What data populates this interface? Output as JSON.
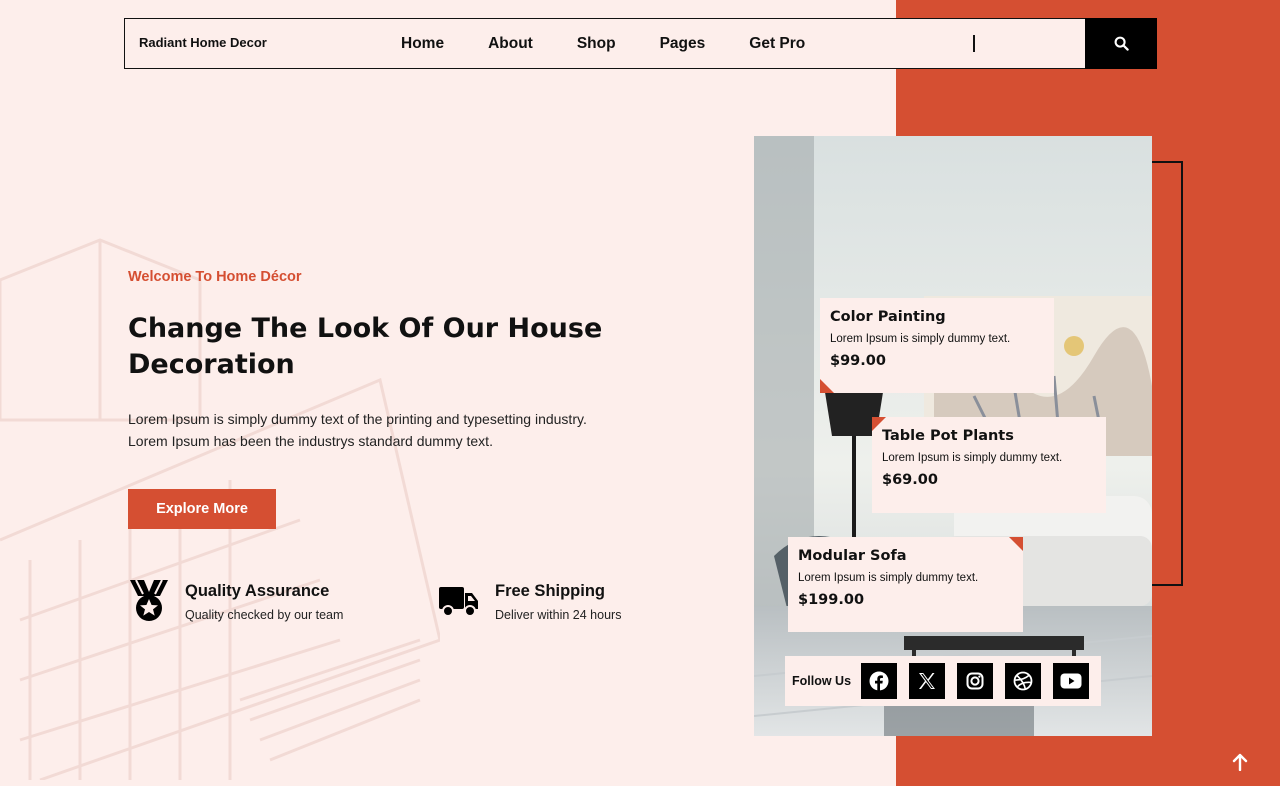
{
  "header": {
    "logo": "Radiant Home Decor",
    "nav": [
      "Home",
      "About",
      "Shop",
      "Pages",
      "Get Pro"
    ],
    "search_placeholder": ""
  },
  "hero": {
    "welcome": "Welcome To Home Décor",
    "headline": "Change The Look Of Our House Decoration",
    "description": "Lorem Ipsum is simply dummy text of the printing and typesetting industry. Lorem Ipsum has been the industrys standard dummy text.",
    "cta_label": "Explore More"
  },
  "features": [
    {
      "title": "Quality Assurance",
      "subtitle": "Quality checked by our team",
      "icon": "medal-icon"
    },
    {
      "title": "Free Shipping",
      "subtitle": "Deliver within 24 hours",
      "icon": "truck-icon"
    }
  ],
  "products": [
    {
      "name": "Color Painting",
      "description": "Lorem Ipsum is simply dummy text.",
      "price": "$99.00"
    },
    {
      "name": "Table Pot Plants",
      "description": "Lorem Ipsum is simply dummy text.",
      "price": "$69.00"
    },
    {
      "name": "Modular Sofa",
      "description": "Lorem Ipsum is simply dummy text.",
      "price": "$199.00"
    }
  ],
  "follow": {
    "label": "Follow Us",
    "icons": [
      "facebook-icon",
      "x-icon",
      "instagram-icon",
      "dribbble-icon",
      "youtube-icon"
    ]
  },
  "colors": {
    "accent": "#d54f32",
    "background": "#fdeeeb",
    "dark": "#000000"
  }
}
